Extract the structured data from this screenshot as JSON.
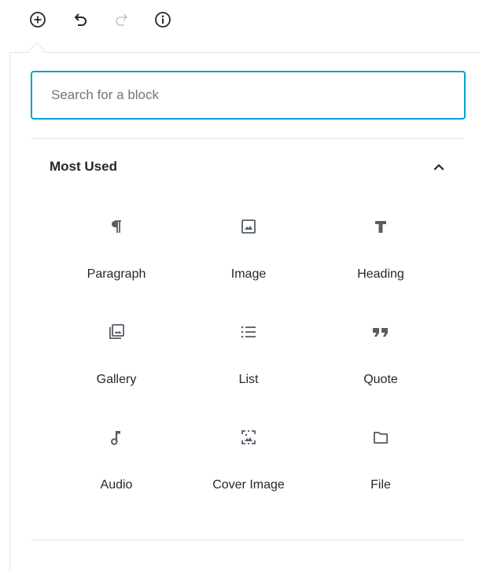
{
  "toolbar": {
    "add": "add-block",
    "undo": "undo",
    "redo": "redo",
    "info": "content-structure"
  },
  "search": {
    "placeholder": "Search for a block",
    "value": ""
  },
  "panel": {
    "title": "Most Used",
    "expanded": true
  },
  "blocks": [
    {
      "label": "Paragraph",
      "icon": "paragraph-icon"
    },
    {
      "label": "Image",
      "icon": "image-icon"
    },
    {
      "label": "Heading",
      "icon": "heading-icon"
    },
    {
      "label": "Gallery",
      "icon": "gallery-icon"
    },
    {
      "label": "List",
      "icon": "list-icon"
    },
    {
      "label": "Quote",
      "icon": "quote-icon"
    },
    {
      "label": "Audio",
      "icon": "audio-icon"
    },
    {
      "label": "Cover Image",
      "icon": "cover-image-icon"
    },
    {
      "label": "File",
      "icon": "file-icon"
    }
  ],
  "colors": {
    "accent": "#00a0d2",
    "icon": "#555d66",
    "text": "#23282d",
    "border": "#e2e4e7",
    "disabled": "#a2aab2"
  }
}
